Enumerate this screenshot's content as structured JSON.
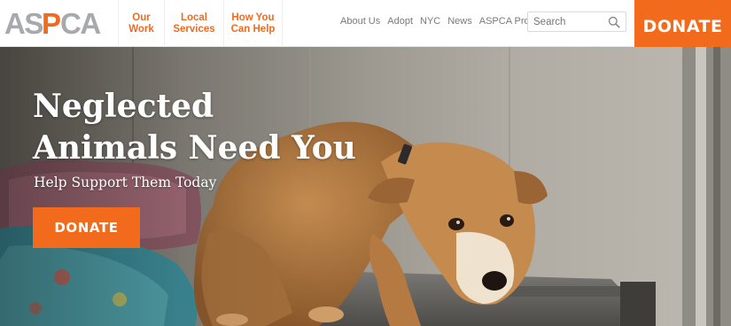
{
  "logo": {
    "text": "ASPCA"
  },
  "main_nav": [
    {
      "line1": "Our",
      "line2": "Work"
    },
    {
      "line1": "Local",
      "line2": "Services"
    },
    {
      "line1": "How You",
      "line2": "Can Help"
    }
  ],
  "util_nav": [
    "About Us",
    "Adopt",
    "NYC",
    "News",
    "ASPCA Pro"
  ],
  "search": {
    "placeholder": "Search"
  },
  "header_donate_label": "DONATE",
  "hero": {
    "headline_line1": "Neglected",
    "headline_line2": "Animals Need You",
    "subheading": "Help Support Them Today",
    "donate_label": "DONATE",
    "image_description": "dog-on-kennel-table-photo"
  },
  "colors": {
    "brand_orange": "#f26b1d",
    "nav_text": "#ee6a21",
    "util_text": "#7a7a7a",
    "logo_gray": "#a7a9ac"
  }
}
